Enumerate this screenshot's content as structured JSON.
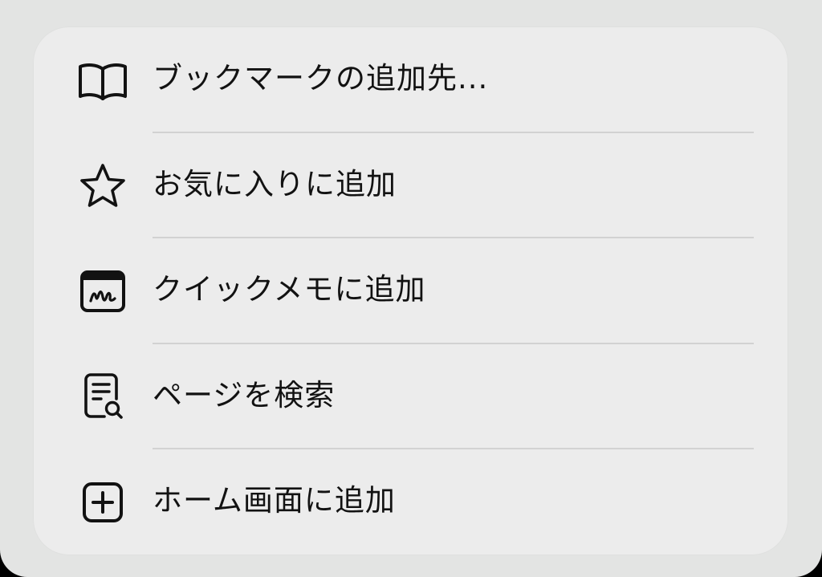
{
  "menu": {
    "items": [
      {
        "icon": "book-icon",
        "label": "ブックマークの追加先..."
      },
      {
        "icon": "star-icon",
        "label": "お気に入りに追加"
      },
      {
        "icon": "quick-note-icon",
        "label": "クイックメモに追加"
      },
      {
        "icon": "find-in-page-icon",
        "label": "ページを検索"
      },
      {
        "icon": "add-square-icon",
        "label": "ホーム画面に追加"
      }
    ]
  },
  "colors": {
    "sheet_background": "#e3e4e3",
    "card_background": "#ececec",
    "text": "#121212",
    "divider": "#d2d2d2"
  }
}
